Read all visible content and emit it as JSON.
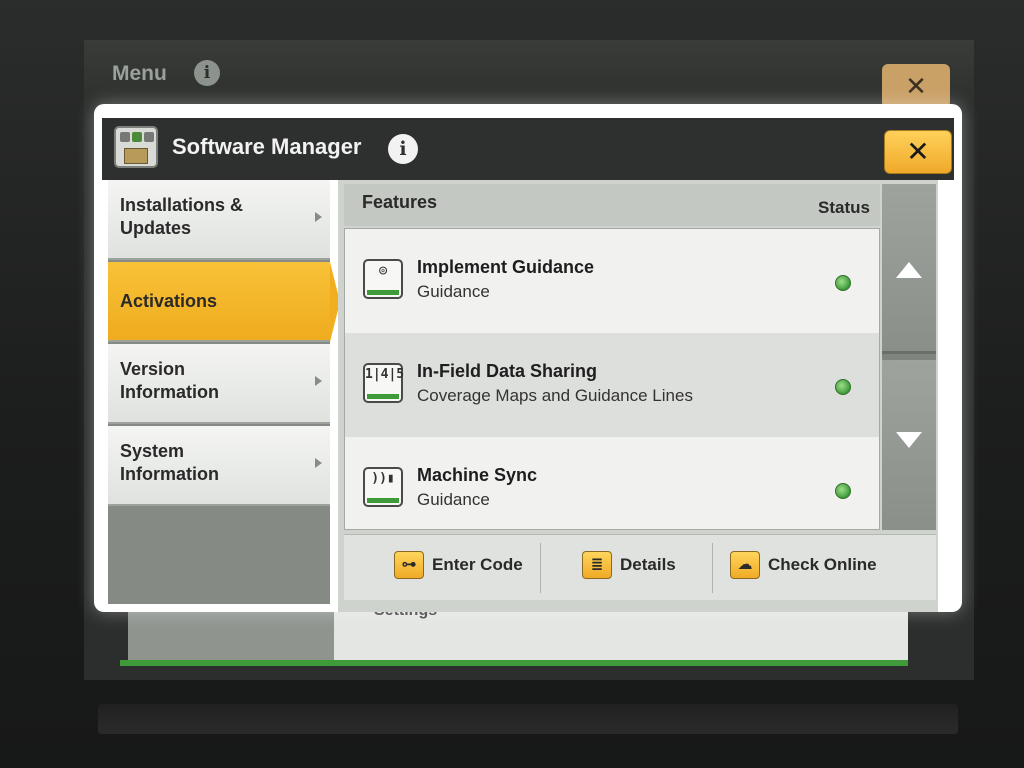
{
  "background": {
    "menu_title": "Menu",
    "info_icon": "info-icon",
    "close_icon": "close-icon",
    "settings_label": "Settings"
  },
  "dialog": {
    "title": "Software Manager",
    "app_icon": "software-manager-icon",
    "info_glyph": "i",
    "close_glyph": "✕"
  },
  "nav": {
    "items": [
      {
        "label": "Installations &\nUpdates",
        "active": false
      },
      {
        "label": "Activations",
        "active": true
      },
      {
        "label": "Version\nInformation",
        "active": false
      },
      {
        "label": "System\nInformation",
        "active": false
      }
    ]
  },
  "features": {
    "header_left": "Features",
    "header_right": "Status",
    "rows": [
      {
        "title": "Implement Guidance",
        "subtitle": "Guidance",
        "icon": "implement-guidance-icon",
        "status": "active"
      },
      {
        "title": "In-Field Data Sharing",
        "subtitle": "Coverage Maps and Guidance Lines",
        "icon": "data-sharing-icon",
        "status": "active"
      },
      {
        "title": "Machine Sync",
        "subtitle": "Guidance",
        "icon": "machine-sync-icon",
        "status": "active"
      }
    ]
  },
  "buttons": {
    "enter_code": "Enter Code",
    "details": "Details",
    "check_online": "Check Online"
  },
  "colors": {
    "accent": "#f0ac20",
    "status_green": "#3f9a3a",
    "header_dark": "#2e302f"
  }
}
